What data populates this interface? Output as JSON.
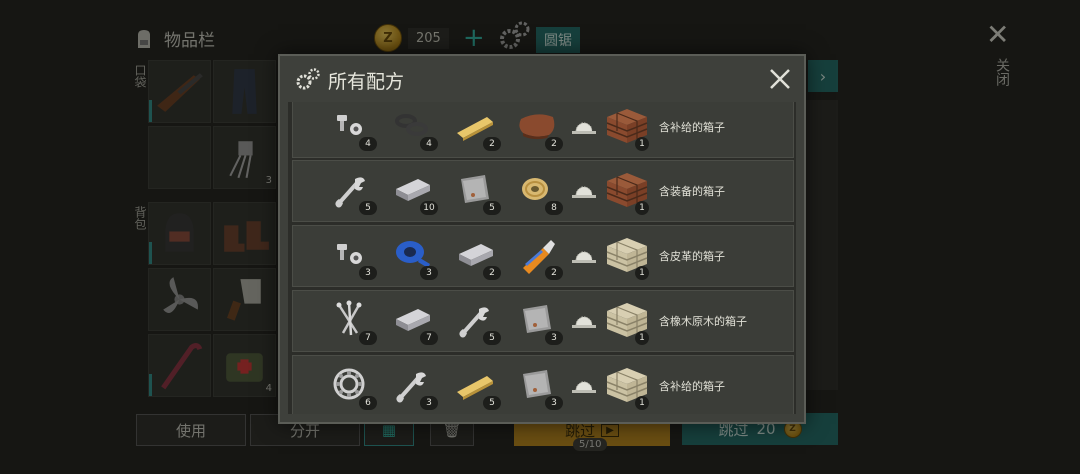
{
  "inventory": {
    "title": "物品栏",
    "coins": "205",
    "workbench_label": "圆锯",
    "close_label": "关闭",
    "pocket_label": "口袋",
    "backpack_label": "背包",
    "slots": [
      {
        "icon": "shotgun-icon",
        "qty": ""
      },
      {
        "icon": "pants-icon",
        "qty": ""
      },
      {
        "icon": "empty-slot",
        "qty": ""
      },
      {
        "icon": "capacitor-icon",
        "qty": "3"
      },
      {
        "icon": "helmet-icon",
        "qty": ""
      },
      {
        "icon": "boots-icon",
        "qty": ""
      },
      {
        "icon": "propeller-icon",
        "qty": ""
      },
      {
        "icon": "cleaver-icon",
        "qty": ""
      },
      {
        "icon": "crowbar-icon",
        "qty": ""
      },
      {
        "icon": "medical-bag-icon",
        "qty": "4"
      }
    ],
    "use_button": "使用",
    "split_button": "分开",
    "skip_ad_label": "跳过",
    "skip_ad_progress": "5/10",
    "skip_coin_label": "跳过",
    "skip_coin_cost": "20"
  },
  "dialog": {
    "title": "所有配方",
    "recipes": [
      {
        "ingredients": [
          {
            "icon": "bolts-icon",
            "count": "4"
          },
          {
            "icon": "washers-icon",
            "count": "4"
          },
          {
            "icon": "plank-icon",
            "count": "2"
          },
          {
            "icon": "leather-icon",
            "count": "2"
          }
        ],
        "station": "saw-icon",
        "result": {
          "name": "含补给的箱子",
          "count": "1",
          "style": "dark"
        }
      },
      {
        "ingredients": [
          {
            "icon": "wrench-icon",
            "count": "5"
          },
          {
            "icon": "metal-bar-icon",
            "count": "10"
          },
          {
            "icon": "metal-plate-icon",
            "count": "5"
          },
          {
            "icon": "wire-spool-icon",
            "count": "8"
          }
        ],
        "station": "saw-icon",
        "result": {
          "name": "含装备的箱子",
          "count": "1",
          "style": "dark"
        }
      },
      {
        "ingredients": [
          {
            "icon": "bolts-icon",
            "count": "3"
          },
          {
            "icon": "duct-tape-icon",
            "count": "3"
          },
          {
            "icon": "metal-bar-icon",
            "count": "2"
          },
          {
            "icon": "glue-icon",
            "count": "2"
          }
        ],
        "station": "saw-icon",
        "result": {
          "name": "含皮革的箱子",
          "count": "1",
          "style": "light"
        }
      },
      {
        "ingredients": [
          {
            "icon": "nails-icon",
            "count": "7"
          },
          {
            "icon": "metal-bar-icon",
            "count": "7"
          },
          {
            "icon": "wrench-icon",
            "count": "5"
          },
          {
            "icon": "metal-plate-icon",
            "count": "3"
          }
        ],
        "station": "saw-icon",
        "result": {
          "name": "含橡木原木的箱子",
          "count": "1",
          "style": "light"
        }
      },
      {
        "ingredients": [
          {
            "icon": "bearing-icon",
            "count": "6"
          },
          {
            "icon": "wrench-icon",
            "count": "3"
          },
          {
            "icon": "plank-icon",
            "count": "5"
          },
          {
            "icon": "metal-plate-icon",
            "count": "3"
          }
        ],
        "station": "saw-icon",
        "result": {
          "name": "含补给的箱子",
          "count": "1",
          "style": "light"
        }
      }
    ]
  },
  "colors": {
    "teal": "#1f6b66",
    "gold": "#b8861a",
    "panel": "#3e403b"
  }
}
